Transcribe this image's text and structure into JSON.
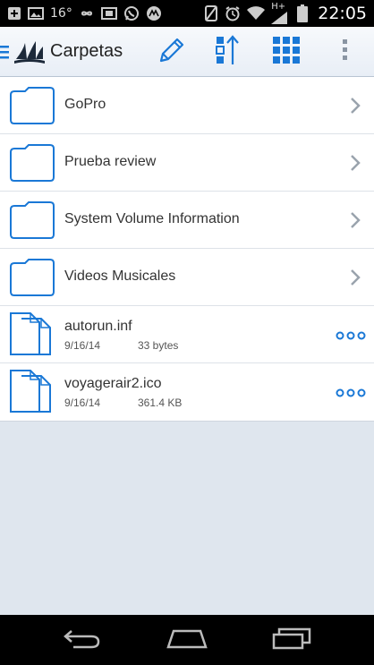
{
  "status_bar": {
    "temperature": "16°",
    "network": "H+",
    "time": "22:05",
    "icons": [
      "add-box-icon",
      "image-icon",
      "temperature-icon",
      "infinity-icon",
      "film-icon",
      "whatsapp-icon",
      "motorola-icon",
      "no-sim-icon",
      "alarm-icon",
      "wifi-icon",
      "signal-icon",
      "battery-icon"
    ]
  },
  "app_bar": {
    "title": "Carpetas",
    "actions": [
      "edit-icon",
      "sort-icon",
      "grid-view-icon",
      "overflow-menu-icon"
    ],
    "accent": "#1a78d6"
  },
  "items": [
    {
      "type": "folder",
      "name": "GoPro"
    },
    {
      "type": "folder",
      "name": "Prueba review"
    },
    {
      "type": "folder",
      "name": "System Volume Information"
    },
    {
      "type": "folder",
      "name": "Videos Musicales"
    },
    {
      "type": "file",
      "name": "autorun.inf",
      "date": "9/16/14",
      "size": "33 bytes"
    },
    {
      "type": "file",
      "name": "voyagerair2.ico",
      "date": "9/16/14",
      "size": "361.4 KB"
    }
  ],
  "nav_bar": {
    "buttons": [
      "back-icon",
      "home-icon",
      "recent-apps-icon"
    ]
  }
}
